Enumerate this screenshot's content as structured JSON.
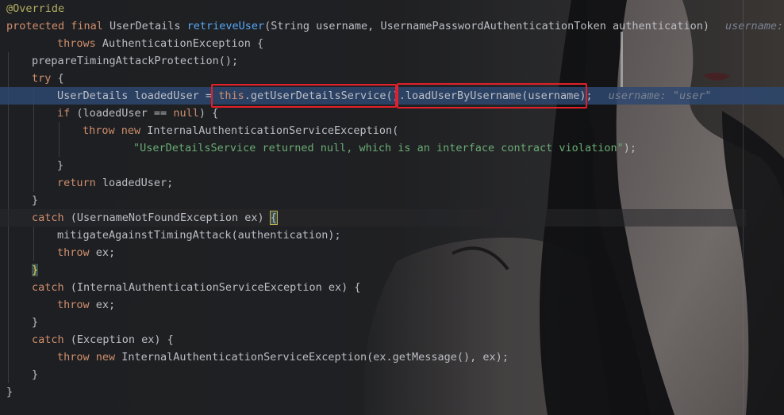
{
  "colors": {
    "keyword": "#cf8e6d",
    "annotation": "#b3ae60",
    "method": "#56a8f5",
    "string": "#6aab73",
    "text": "#bcbec4",
    "hint": "#7a8291",
    "highlight_box": "#e0202a",
    "current_line": "#2e4870"
  },
  "code": {
    "l1": {
      "ann": "@Override"
    },
    "l2": {
      "kw1": "protected final ",
      "t1": "UserDetails ",
      "fn": "retrieveUser",
      "t2": "(String username, UsernamePasswordAuthenticationToken authentication)",
      "hint": "username: \""
    },
    "l3": {
      "kw": "throws ",
      "t": "AuthenticationException {"
    },
    "l4": {
      "t": "prepareTimingAttackProtection();"
    },
    "l5": {
      "kw": "try",
      "t": " {"
    },
    "l6": {
      "t1": "UserDetails loadedUser = ",
      "kw": "this",
      "t2": ".getUserDetailsService()",
      "t3": ".loadUserByUsername(username);",
      "hint": "username: \"user\""
    },
    "l7": {
      "kw1": "if",
      "t1": " (loadedUser == ",
      "kw2": "null",
      "t2": ") {"
    },
    "l8": {
      "kw": "throw new ",
      "t": "InternalAuthenticationServiceException("
    },
    "l9": {
      "str": "\"UserDetailsService returned null, which is an interface contract violation\"",
      "t": ");"
    },
    "l10": {
      "t": "}"
    },
    "l11": {
      "kw": "return ",
      "t": "loadedUser;"
    },
    "l12": {
      "t": "}"
    },
    "l13": {
      "kw": "catch",
      "t": " (UsernameNotFoundException ex) ",
      "brace": "{"
    },
    "l14": {
      "t": "mitigateAgainstTimingAttack(authentication);"
    },
    "l15": {
      "kw": "throw ",
      "t": "ex;"
    },
    "l16": {
      "brace": "}"
    },
    "l17": {
      "kw": "catch",
      "t": " (InternalAuthenticationServiceException ex) {"
    },
    "l18": {
      "kw": "throw ",
      "t": "ex;"
    },
    "l19": {
      "t": "}"
    },
    "l20": {
      "kw": "catch",
      "t": " (Exception ex) {"
    },
    "l21": {
      "kw": "throw new ",
      "t": "InternalAuthenticationServiceException(ex.getMessage(), ex);"
    },
    "l22": {
      "t": "}"
    },
    "l23": {
      "t": "}"
    }
  }
}
